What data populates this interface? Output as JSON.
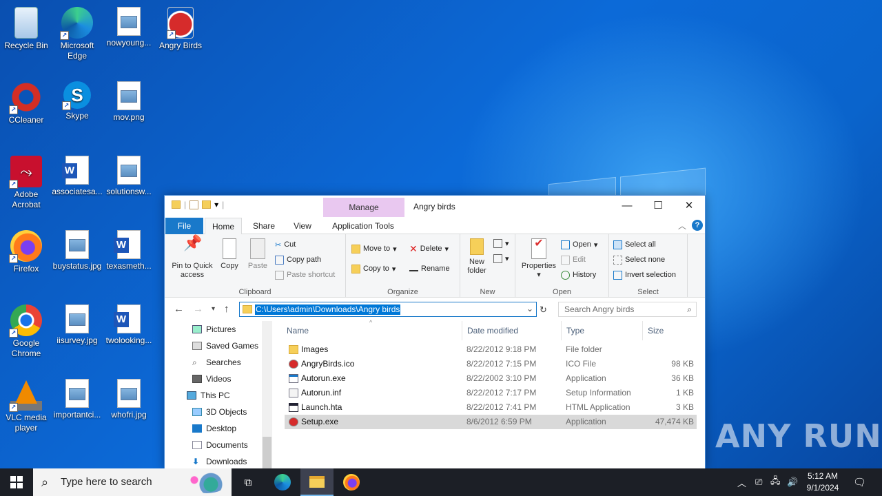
{
  "desktop": {
    "icons": [
      {
        "label": "Recycle Bin"
      },
      {
        "label": "Microsoft Edge"
      },
      {
        "label": "nowyoung..."
      },
      {
        "label": "Angry Birds"
      },
      {
        "label": "CCleaner"
      },
      {
        "label": "Skype"
      },
      {
        "label": "mov.png"
      },
      {
        "label": "Adobe Acrobat"
      },
      {
        "label": "associatesa..."
      },
      {
        "label": "solutionsw..."
      },
      {
        "label": "Firefox"
      },
      {
        "label": "buystatus.jpg"
      },
      {
        "label": "texasmeth..."
      },
      {
        "label": "Google Chrome"
      },
      {
        "label": "iisurvey.jpg"
      },
      {
        "label": "twolooking..."
      },
      {
        "label": "VLC media player"
      },
      {
        "label": "importantci..."
      },
      {
        "label": "whofri.jpg"
      }
    ]
  },
  "explorer": {
    "title": "Angry birds",
    "manage_tab": "Manage",
    "tabs": {
      "file": "File",
      "home": "Home",
      "share": "Share",
      "view": "View",
      "app_tools": "Application Tools"
    },
    "ribbon": {
      "clipboard": {
        "label": "Clipboard",
        "pin": "Pin to Quick access",
        "copy": "Copy",
        "paste": "Paste",
        "cut": "Cut",
        "copy_path": "Copy path",
        "paste_shortcut": "Paste shortcut"
      },
      "organize": {
        "label": "Organize",
        "move_to": "Move to",
        "copy_to": "Copy to",
        "delete": "Delete",
        "rename": "Rename"
      },
      "new": {
        "label": "New",
        "new_folder": "New folder"
      },
      "open": {
        "label": "Open",
        "properties": "Properties",
        "open": "Open",
        "edit": "Edit",
        "history": "History"
      },
      "select": {
        "label": "Select",
        "select_all": "Select all",
        "select_none": "Select none",
        "invert": "Invert selection"
      }
    },
    "address": "C:\\Users\\admin\\Downloads\\Angry birds",
    "search_placeholder": "Search Angry birds",
    "nav": [
      "Pictures",
      "Saved Games",
      "Searches",
      "Videos",
      "This PC",
      "3D Objects",
      "Desktop",
      "Documents",
      "Downloads"
    ],
    "columns": {
      "name": "Name",
      "date": "Date modified",
      "type": "Type",
      "size": "Size"
    },
    "files": [
      {
        "name": "Images",
        "date": "8/22/2012 9:18 PM",
        "type": "File folder",
        "size": ""
      },
      {
        "name": "AngryBirds.ico",
        "date": "8/22/2012 7:15 PM",
        "type": "ICO File",
        "size": "98 KB"
      },
      {
        "name": "Autorun.exe",
        "date": "8/22/2002 3:10 PM",
        "type": "Application",
        "size": "36 KB"
      },
      {
        "name": "Autorun.inf",
        "date": "8/22/2012 7:17 PM",
        "type": "Setup Information",
        "size": "1 KB"
      },
      {
        "name": "Launch.hta",
        "date": "8/22/2012 7:41 PM",
        "type": "HTML Application",
        "size": "3 KB"
      },
      {
        "name": "Setup.exe",
        "date": "8/6/2012 6:59 PM",
        "type": "Application",
        "size": "47,474 KB"
      }
    ]
  },
  "taskbar": {
    "search_placeholder": "Type here to search",
    "time": "5:12 AM",
    "date": "9/1/2024"
  },
  "watermark": "ANY RUN"
}
